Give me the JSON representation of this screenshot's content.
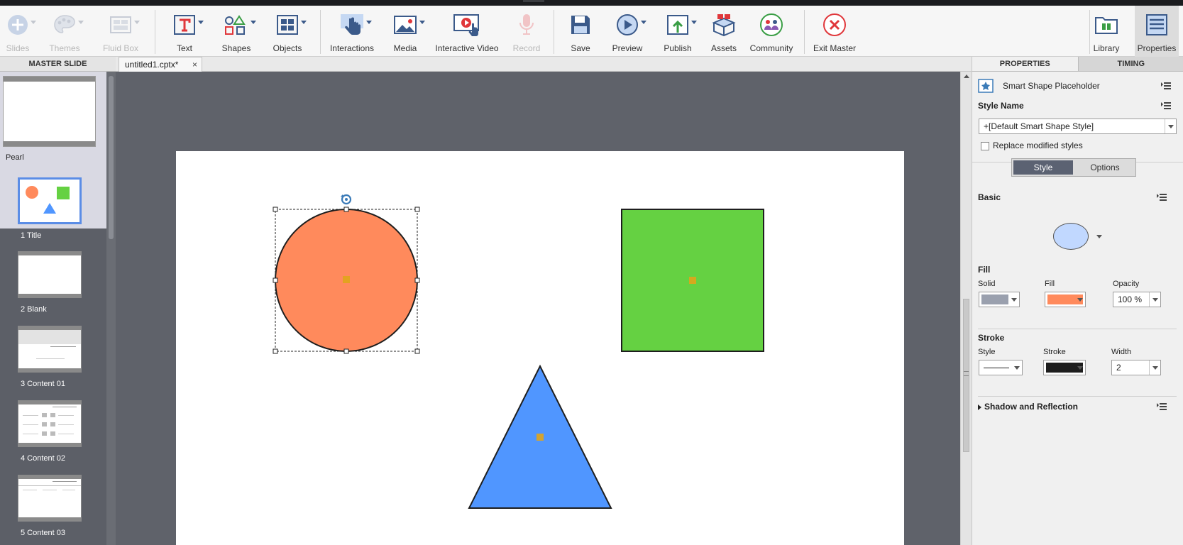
{
  "toolbar": {
    "slides": "Slides",
    "themes": "Themes",
    "fluid_box": "Fluid Box",
    "text": "Text",
    "shapes": "Shapes",
    "objects": "Objects",
    "interactions": "Interactions",
    "media": "Media",
    "interactive_video": "Interactive Video",
    "record": "Record",
    "save": "Save",
    "preview": "Preview",
    "publish": "Publish",
    "assets": "Assets",
    "community": "Community",
    "exit_master": "Exit Master",
    "library": "Library",
    "properties": "Properties"
  },
  "left_panel": {
    "header": "MASTER SLIDE",
    "master_name": "Pearl",
    "slides": [
      {
        "label": "1 Title"
      },
      {
        "label": "2 Blank"
      },
      {
        "label": "3 Content 01"
      },
      {
        "label": "4 Content 02"
      },
      {
        "label": "5 Content 03"
      }
    ]
  },
  "document": {
    "tab_name": "untitled1.cptx*",
    "close": "×"
  },
  "stage": {
    "shapes": [
      {
        "type": "circle",
        "fill": "#ff8a5c",
        "selected": true
      },
      {
        "type": "square",
        "fill": "#65d142",
        "selected": false
      },
      {
        "type": "triangle",
        "fill": "#5096ff",
        "selected": false
      }
    ]
  },
  "right_panel": {
    "tab_properties": "PROPERTIES",
    "tab_timing": "TIMING",
    "object_name": "Smart Shape Placeholder",
    "style_name_label": "Style Name",
    "style_name_value": "+[Default Smart Shape Style]",
    "replace_modified": "Replace modified styles",
    "seg_style": "Style",
    "seg_options": "Options",
    "basic": "Basic",
    "fill_section": "Fill",
    "fill_solid_label": "Solid",
    "fill_color_label": "Fill",
    "opacity_label": "Opacity",
    "opacity_value": "100 %",
    "stroke_section": "Stroke",
    "stroke_style_label": "Style",
    "stroke_color_label": "Stroke",
    "width_label": "Width",
    "width_value": "2",
    "shadow_reflection": "Shadow and Reflection",
    "colors": {
      "solid_swatch": "#9aa0ae",
      "fill_swatch": "#ff8a5c",
      "stroke_swatch": "#1e1e1e",
      "preview_shape": "#c1d8ff"
    }
  }
}
